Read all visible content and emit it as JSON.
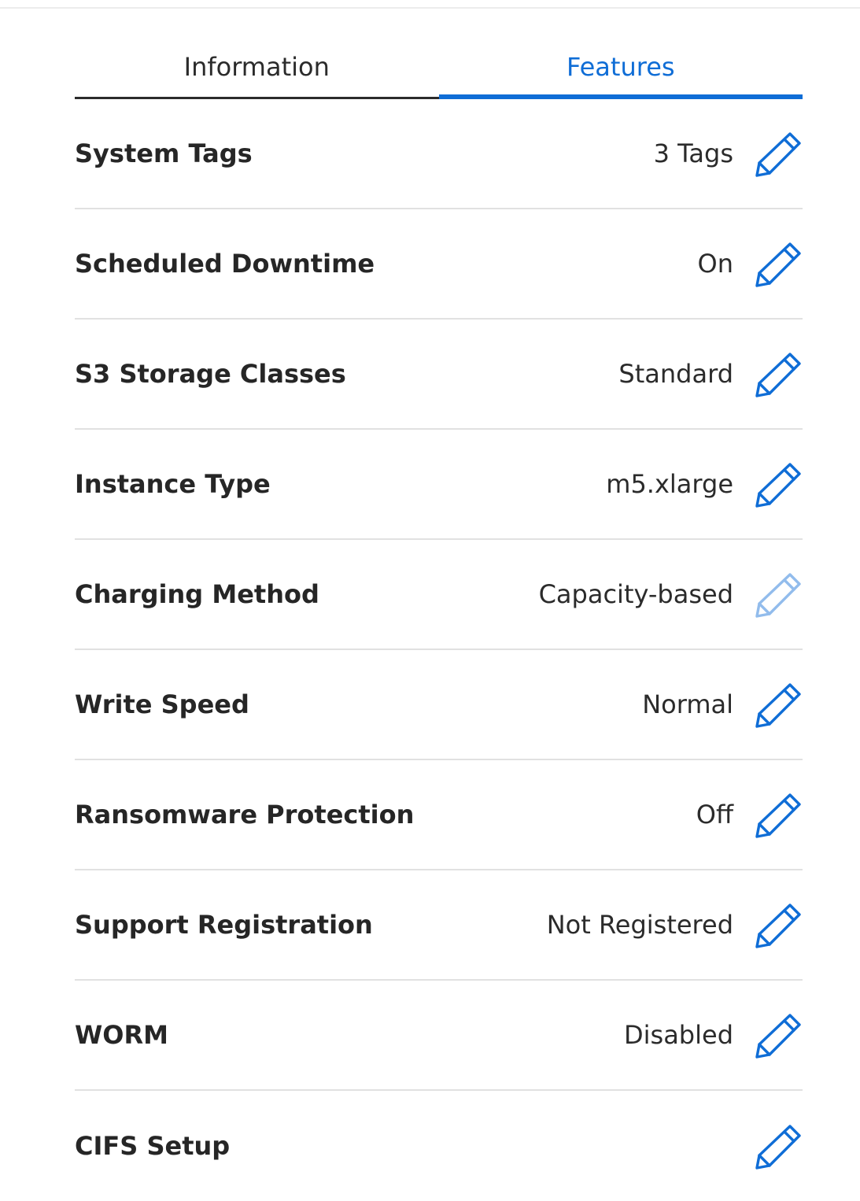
{
  "tabs": [
    {
      "label": "Information",
      "active": false
    },
    {
      "label": "Features",
      "active": true
    }
  ],
  "accent_color": "#0f6dd6",
  "edit_icon": "pencil-icon",
  "features": [
    {
      "key": "system-tags",
      "label": "System Tags",
      "value": "3 Tags",
      "editable": true
    },
    {
      "key": "scheduled-downtime",
      "label": "Scheduled Downtime",
      "value": "On",
      "editable": true
    },
    {
      "key": "s3-storage-classes",
      "label": "S3 Storage Classes",
      "value": "Standard",
      "editable": true
    },
    {
      "key": "instance-type",
      "label": "Instance Type",
      "value": "m5.xlarge",
      "editable": true
    },
    {
      "key": "charging-method",
      "label": "Charging Method",
      "value": "Capacity-based",
      "editable": false
    },
    {
      "key": "write-speed",
      "label": "Write Speed",
      "value": "Normal",
      "editable": true
    },
    {
      "key": "ransomware-protection",
      "label": "Ransomware Protection",
      "value": "Off",
      "editable": true
    },
    {
      "key": "support-registration",
      "label": "Support Registration",
      "value": "Not Registered",
      "editable": true
    },
    {
      "key": "worm",
      "label": "WORM",
      "value": "Disabled",
      "editable": true
    },
    {
      "key": "cifs-setup",
      "label": "CIFS Setup",
      "value": "",
      "editable": true
    }
  ]
}
